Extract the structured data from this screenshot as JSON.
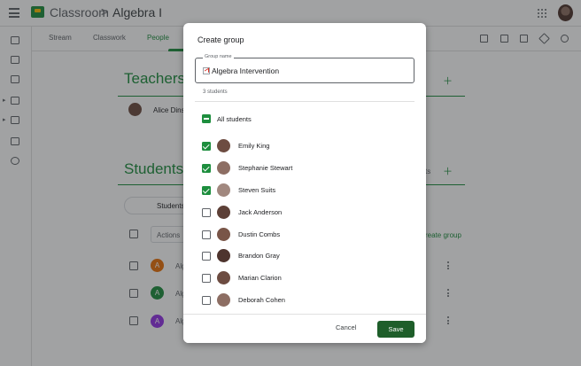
{
  "header": {
    "app_name": "Classroom",
    "separator": ">",
    "class_name": "Algebra I"
  },
  "tabs": [
    {
      "label": "Stream"
    },
    {
      "label": "Classwork"
    },
    {
      "label": "People"
    }
  ],
  "teachers": {
    "title": "Teachers",
    "name": "Alice Dins"
  },
  "students": {
    "title": "Students",
    "suffix": "ts",
    "filter_label": "Students",
    "actions_label": "Actions",
    "create_group_link": "reate group",
    "rows": [
      {
        "initial": "A",
        "color": "#e8710a",
        "text": "Alg"
      },
      {
        "initial": "A",
        "color": "#1e8e3e",
        "text": "Alg"
      },
      {
        "initial": "A",
        "color": "#9334e6",
        "text": "Alg"
      }
    ]
  },
  "dialog": {
    "title": "Create group",
    "group_name_label": "Group name",
    "group_name_value": "Algebra Intervention",
    "selected_count": "3 students",
    "all_students_label": "All students",
    "cancel_label": "Cancel",
    "save_label": "Save",
    "accent": "#1e8e3e",
    "students": [
      {
        "name": "Emily King",
        "checked": true,
        "avatar": "#6d4c41"
      },
      {
        "name": "Stephanie Stewart",
        "checked": true,
        "avatar": "#8d6e63"
      },
      {
        "name": "Steven Suits",
        "checked": true,
        "avatar": "#a1887f"
      },
      {
        "name": "Jack Anderson",
        "checked": false,
        "avatar": "#5d4037"
      },
      {
        "name": "Dustin Combs",
        "checked": false,
        "avatar": "#795548"
      },
      {
        "name": "Brandon Gray",
        "checked": false,
        "avatar": "#4e342e"
      },
      {
        "name": "Marian Clarion",
        "checked": false,
        "avatar": "#6d4c41"
      },
      {
        "name": "Deborah Cohen",
        "checked": false,
        "avatar": "#8d6e63"
      }
    ]
  }
}
